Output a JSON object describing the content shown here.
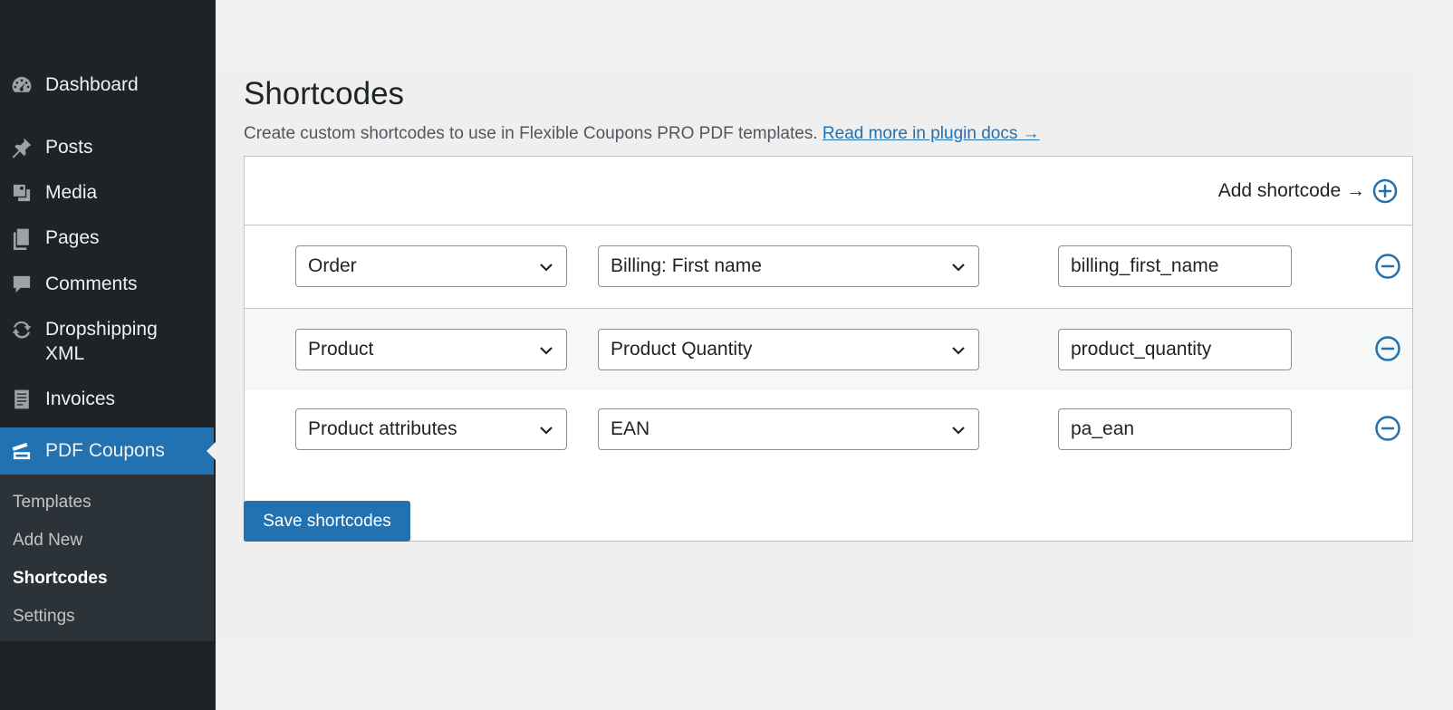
{
  "sidebar": {
    "items": [
      {
        "label": "Dashboard",
        "icon": "dashboard-icon"
      },
      {
        "label": "Posts",
        "icon": "pin-icon"
      },
      {
        "label": "Media",
        "icon": "media-icon"
      },
      {
        "label": "Pages",
        "icon": "pages-icon"
      },
      {
        "label": "Comments",
        "icon": "comments-icon"
      },
      {
        "label": "Dropshipping\nXML",
        "icon": "sync-icon"
      },
      {
        "label": "Invoices",
        "icon": "invoice-icon"
      },
      {
        "label": "PDF Coupons",
        "icon": "coupons-icon",
        "active": true
      }
    ],
    "submenu": [
      {
        "label": "Templates"
      },
      {
        "label": "Add New"
      },
      {
        "label": "Shortcodes",
        "current": true
      },
      {
        "label": "Settings"
      }
    ]
  },
  "main": {
    "title": "Shortcodes",
    "description": "Create custom shortcodes to use in Flexible Coupons PRO PDF templates.",
    "docs_link": "Read more in plugin docs →",
    "add_label": "Add shortcode →",
    "rows": [
      {
        "group": "Order",
        "field": "Billing: First name",
        "shortcode": "billing_first_name"
      },
      {
        "group": "Product",
        "field": "Product Quantity",
        "shortcode": "product_quantity"
      },
      {
        "group": "Product attributes",
        "field": "EAN",
        "shortcode": "pa_ean"
      }
    ],
    "save_label": "Save shortcodes"
  },
  "colors": {
    "accent": "#2271b1",
    "sidebar_bg": "#1d2327",
    "submenu_bg": "#2c3338",
    "page_bg": "#f0f0f1"
  }
}
